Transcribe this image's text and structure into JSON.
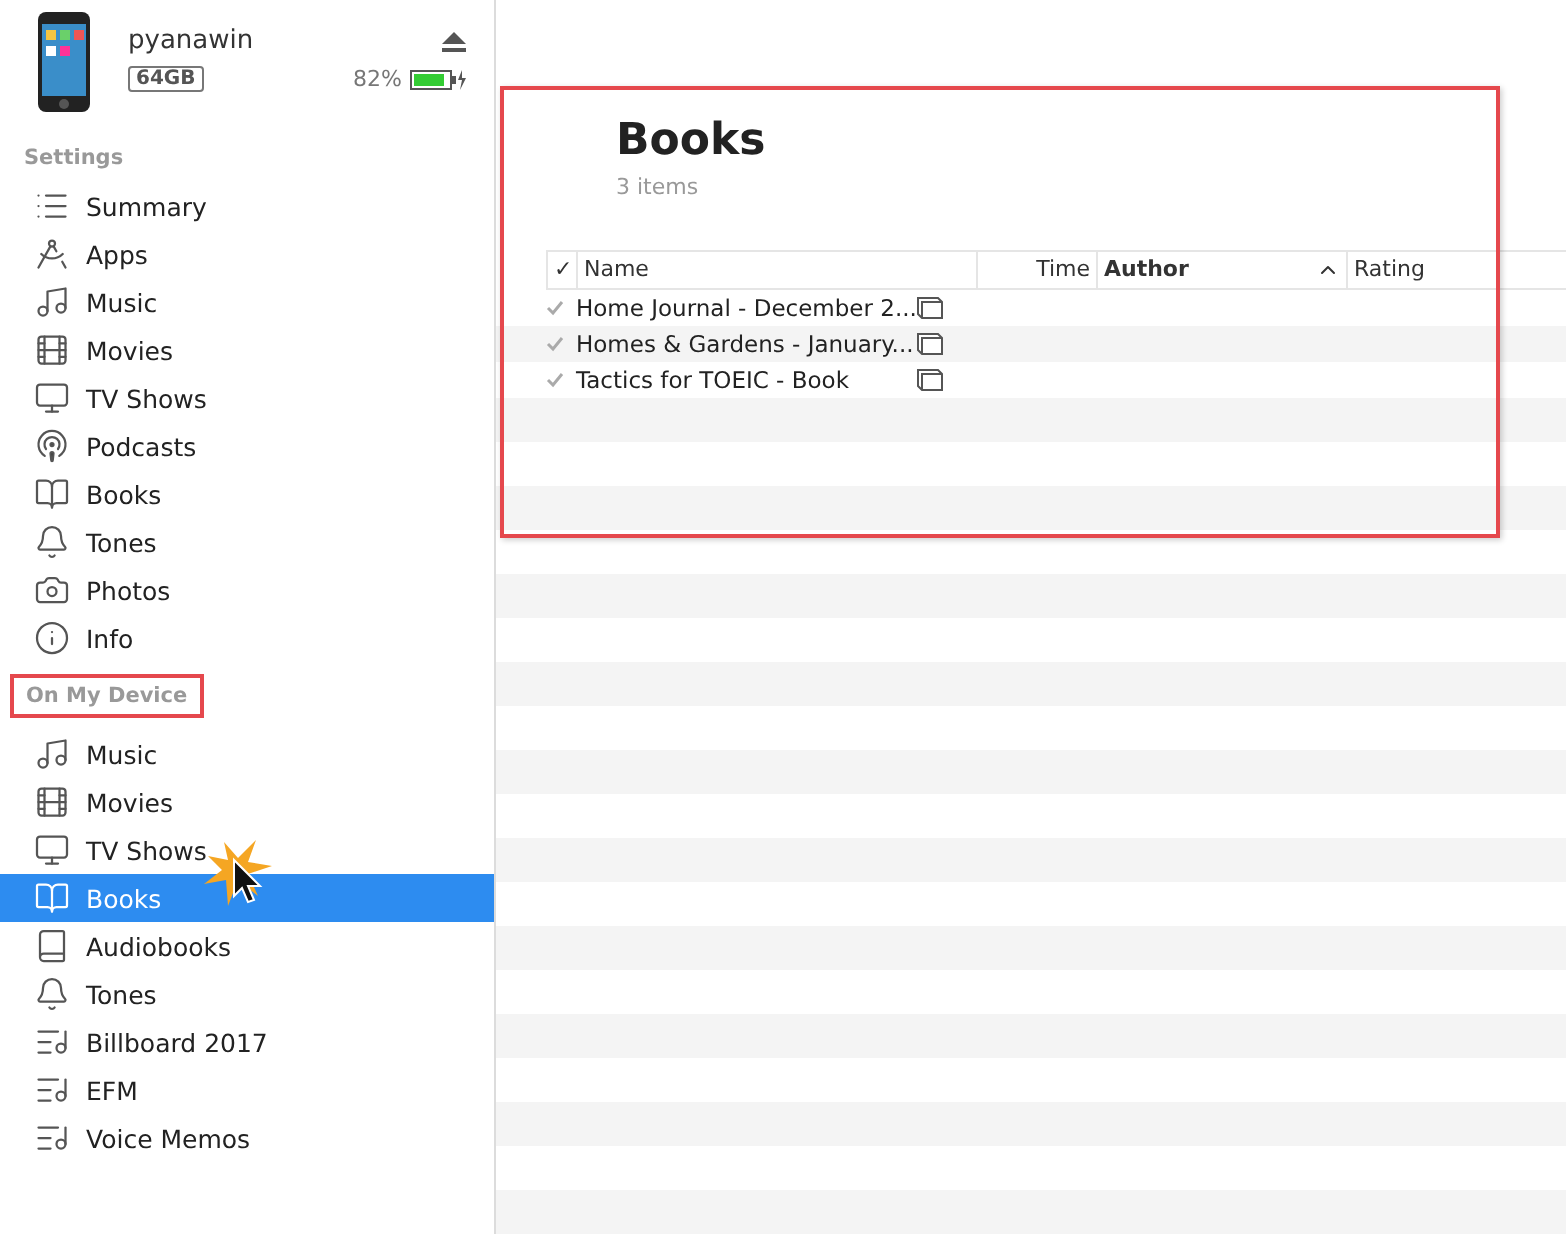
{
  "device": {
    "name": "pyanawin",
    "capacity": "64GB",
    "battery": "82%"
  },
  "sidebar": {
    "sections": [
      {
        "heading": "Settings",
        "highlighted": false,
        "items": [
          {
            "label": "Summary",
            "kind": "summary",
            "selected": false
          },
          {
            "label": "Apps",
            "kind": "apps",
            "selected": false
          },
          {
            "label": "Music",
            "kind": "music",
            "selected": false
          },
          {
            "label": "Movies",
            "kind": "movies",
            "selected": false
          },
          {
            "label": "TV Shows",
            "kind": "tv",
            "selected": false
          },
          {
            "label": "Podcasts",
            "kind": "podcasts",
            "selected": false
          },
          {
            "label": "Books",
            "kind": "books",
            "selected": false
          },
          {
            "label": "Tones",
            "kind": "tones",
            "selected": false
          },
          {
            "label": "Photos",
            "kind": "photos",
            "selected": false
          },
          {
            "label": "Info",
            "kind": "info",
            "selected": false
          }
        ]
      },
      {
        "heading": "On My Device",
        "highlighted": true,
        "items": [
          {
            "label": "Music",
            "kind": "music",
            "selected": false
          },
          {
            "label": "Movies",
            "kind": "movies",
            "selected": false
          },
          {
            "label": "TV Shows",
            "kind": "tv",
            "selected": false
          },
          {
            "label": "Books",
            "kind": "books",
            "selected": true
          },
          {
            "label": "Audiobooks",
            "kind": "audiobooks",
            "selected": false
          },
          {
            "label": "Tones",
            "kind": "tones",
            "selected": false
          },
          {
            "label": "Billboard 2017",
            "kind": "playlist",
            "selected": false
          },
          {
            "label": "EFM",
            "kind": "playlist",
            "selected": false
          },
          {
            "label": "Voice Memos",
            "kind": "playlist",
            "selected": false
          }
        ]
      }
    ]
  },
  "content": {
    "title": "Books",
    "count": "3 items",
    "highlighted": true,
    "columns": [
      {
        "label": "✓",
        "kind": "check",
        "sorted": false
      },
      {
        "label": "Name",
        "kind": "name",
        "sorted": false
      },
      {
        "label": "Time",
        "kind": "time",
        "sorted": false
      },
      {
        "label": "Author",
        "kind": "author",
        "sorted": true
      },
      {
        "label": "Rating",
        "kind": "rating",
        "sorted": false
      }
    ],
    "rows": [
      {
        "checked": true,
        "name": "Home Journal - December 2..."
      },
      {
        "checked": true,
        "name": "Homes & Gardens - January..."
      },
      {
        "checked": true,
        "name": "Tactics for TOEIC - Book"
      }
    ]
  }
}
